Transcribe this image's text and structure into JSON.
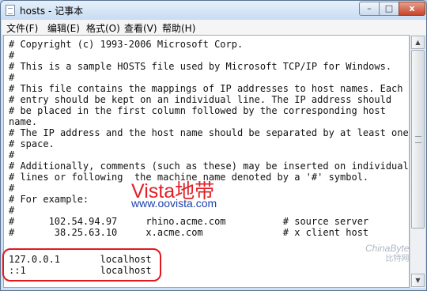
{
  "window": {
    "title": "hosts - 记事本",
    "minimize": "–",
    "maximize": "□",
    "close": "x"
  },
  "menu": [
    "文件(F)",
    "编辑(E)",
    "格式(O)",
    "查看(V)",
    "帮助(H)"
  ],
  "content": {
    "lines": [
      "# Copyright (c) 1993-2006 Microsoft Corp.",
      "#",
      "# This is a sample HOSTS file used by Microsoft TCP/IP for Windows.",
      "#",
      "# This file contains the mappings of IP addresses to host names. Each",
      "# entry should be kept on an individual line. The IP address should",
      "# be placed in the first column followed by the corresponding host",
      "name.",
      "# The IP address and the host name should be separated by at least one",
      "# space.",
      "#",
      "# Additionally, comments (such as these) may be inserted on individual",
      "# lines or following  the machine name denoted by a '#' symbol.",
      "#",
      "# For example:",
      "#",
      "#      102.54.94.97     rhino.acme.com          # source server",
      "#       38.25.63.10     x.acme.com              # x client host",
      "",
      "127.0.0.1       localhost",
      "::1             localhost"
    ]
  },
  "watermark": {
    "brand": "Vista地带",
    "url": "www.oovista.com",
    "corner": "ChinaByte",
    "corner_sub": "比特网"
  }
}
